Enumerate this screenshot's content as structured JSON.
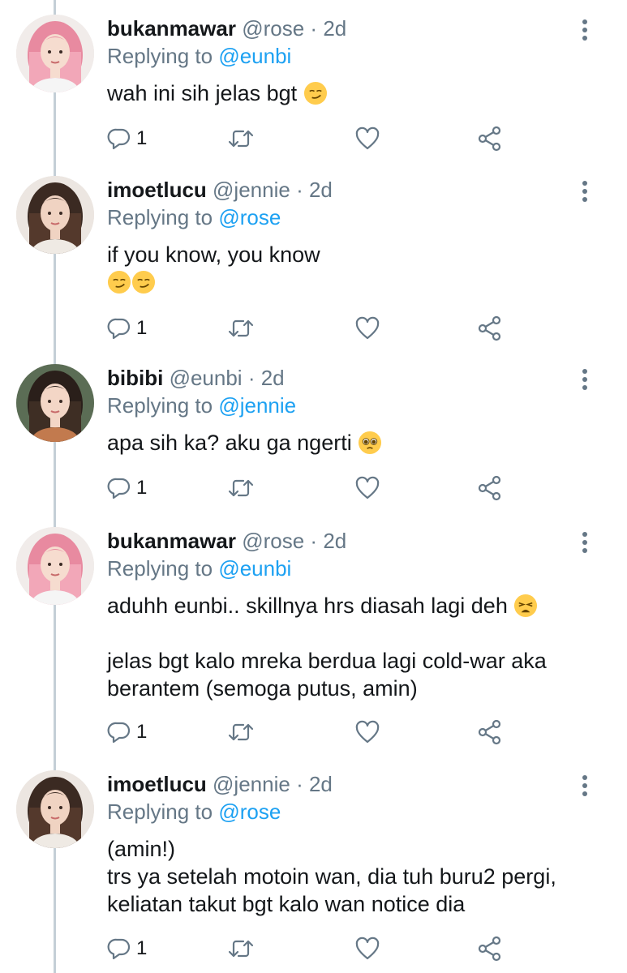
{
  "tweets": [
    {
      "name": "bukanmawar",
      "handle": "@rose",
      "time": "2d",
      "replying_prefix": "Replying to",
      "replying_to": "@eunbi",
      "lines": [
        "wah ini sih jelas bgt"
      ],
      "emoji_lines": [
        [
          "smirk"
        ]
      ],
      "reply_count": "1",
      "avatar": "pink-hair"
    },
    {
      "name": "imoetlucu",
      "handle": "@jennie",
      "time": "2d",
      "replying_prefix": "Replying to",
      "replying_to": "@rose",
      "lines": [
        "if you know, you know",
        ""
      ],
      "emoji_lines": [
        [],
        [
          "smirk",
          "smirk"
        ]
      ],
      "reply_count": "1",
      "avatar": "dark-hair"
    },
    {
      "name": "bibibi",
      "handle": "@eunbi",
      "time": "2d",
      "replying_prefix": "Replying to",
      "replying_to": "@jennie",
      "lines": [
        "apa sih ka? aku ga ngerti"
      ],
      "emoji_lines": [
        [
          "pleading"
        ]
      ],
      "reply_count": "1",
      "avatar": "long-hair"
    },
    {
      "name": "bukanmawar",
      "handle": "@rose",
      "time": "2d",
      "replying_prefix": "Replying to",
      "replying_to": "@eunbi",
      "lines": [
        "aduhh eunbi.. skillnya hrs diasah lagi deh",
        "",
        "jelas bgt kalo mreka berdua lagi cold-war aka",
        "berantem (semoga putus, amin)"
      ],
      "emoji_lines": [
        [
          "weary"
        ],
        [],
        [],
        []
      ],
      "reply_count": "1",
      "avatar": "pink-hair"
    },
    {
      "name": "imoetlucu",
      "handle": "@jennie",
      "time": "2d",
      "replying_prefix": "Replying to",
      "replying_to": "@rose",
      "lines": [
        "(amin!)",
        "trs ya setelah motoin wan, dia tuh buru2 pergi,",
        "keliatan takut bgt kalo wan notice dia"
      ],
      "emoji_lines": [
        [],
        [],
        []
      ],
      "reply_count": "1",
      "avatar": "dark-hair"
    }
  ],
  "icons": {
    "reply": "reply-icon",
    "retweet": "retweet-icon",
    "like": "heart-icon",
    "share": "share-icon",
    "more": "more-vertical-icon"
  },
  "colors": {
    "text": "#14171a",
    "secondary": "#657786",
    "link": "#1da1f2",
    "thread_line": "#c4cfd6"
  }
}
